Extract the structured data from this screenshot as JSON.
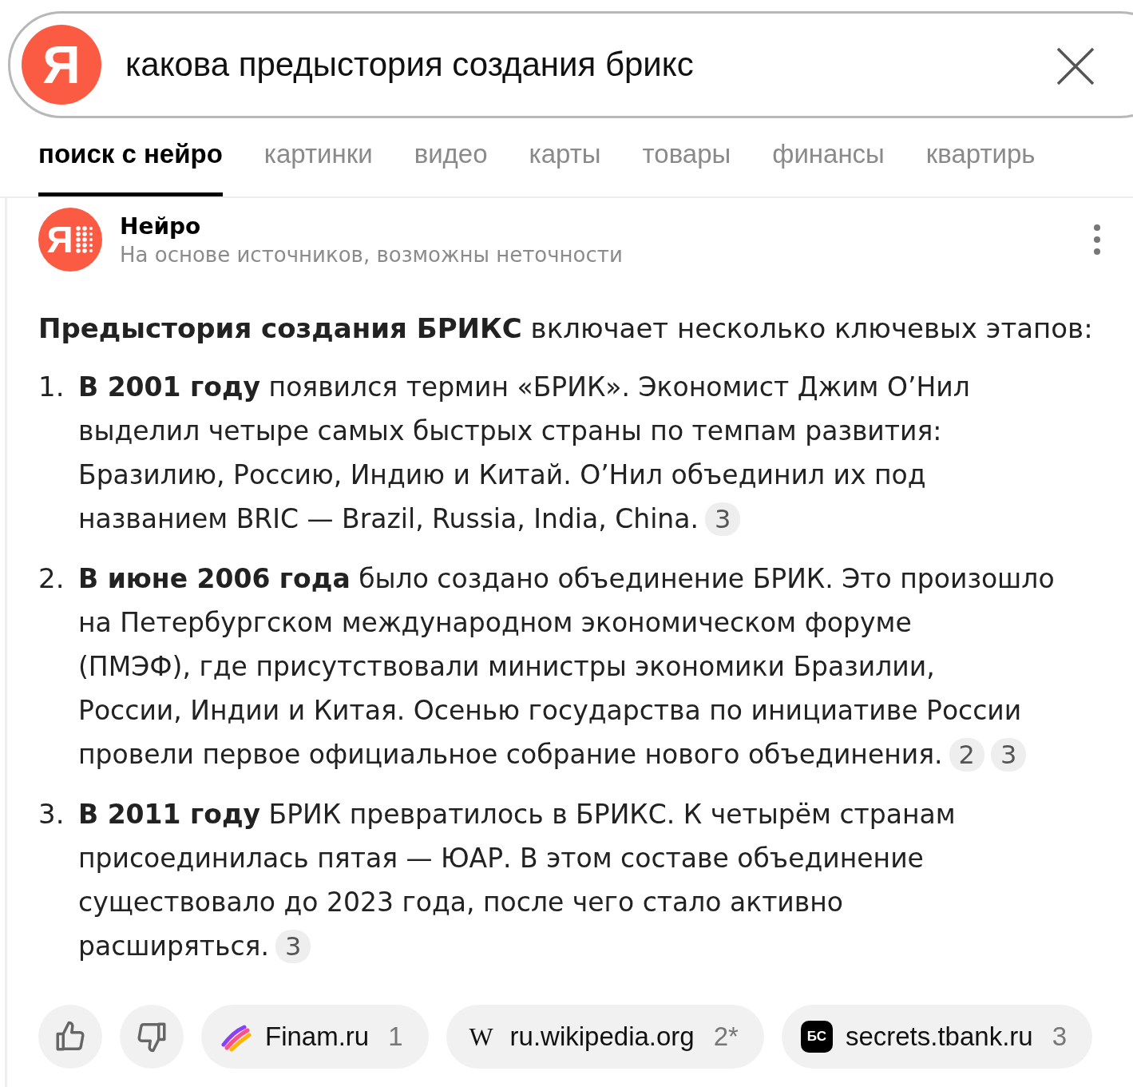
{
  "search": {
    "logo": "Я",
    "query": "какова предыстория создания брикс"
  },
  "tabs": [
    {
      "label": "поиск с нейро",
      "selected": true
    },
    {
      "label": "картинки",
      "selected": false
    },
    {
      "label": "видео",
      "selected": false
    },
    {
      "label": "карты",
      "selected": false
    },
    {
      "label": "товары",
      "selected": false
    },
    {
      "label": "финансы",
      "selected": false
    },
    {
      "label": "квартирь",
      "selected": false
    }
  ],
  "answer": {
    "author": "Нейро",
    "author_logo": "Я",
    "disclaimer": "На основе источников, возможны неточности",
    "intro": "**Предыстория создания БРИКС** включает несколько ключевых этапов:",
    "items": [
      {
        "number": "1.",
        "lines": [
          "**В 2001 году** появился термин «БРИК». Экономист Джим О’Нил",
          "выделил четыре самых быстрых страны по темпам развития:",
          "Бразилию, Россию, Индию и Китай. О’Нил объединил их под",
          "названием BRIC — Brazil, Russia, India, China."
        ],
        "refs": [
          "3"
        ]
      },
      {
        "number": "2.",
        "lines": [
          "**В июне 2006 года** было создано объединение БРИК. Это произошло",
          "на Петербургском международном экономическом форуме",
          "(ПМЭФ), где присутствовали министры экономики Бразилии,",
          "России, Индии и Китая. Осенью государства по инициативе России",
          "провели первое официальное собрание нового объединения."
        ],
        "refs": [
          "2",
          "3"
        ]
      },
      {
        "number": "3.",
        "lines": [
          "**В 2011 году** БРИК превратилось в БРИКС. К четырём странам",
          "присоединилась пятая — ЮАР. В этом составе объединение",
          "существовало до 2023 года, после чего стало активно",
          "расширяться."
        ],
        "refs": [
          "3"
        ]
      }
    ]
  },
  "sources": [
    {
      "kind": "finam",
      "name": "Finam.ru",
      "ref": "1"
    },
    {
      "kind": "letter",
      "logo": "W",
      "name": "ru.wikipedia.org",
      "ref": "2*"
    },
    {
      "kind": "badge",
      "logo": "БС",
      "name": "secrets.tbank.ru",
      "ref": "3"
    }
  ]
}
